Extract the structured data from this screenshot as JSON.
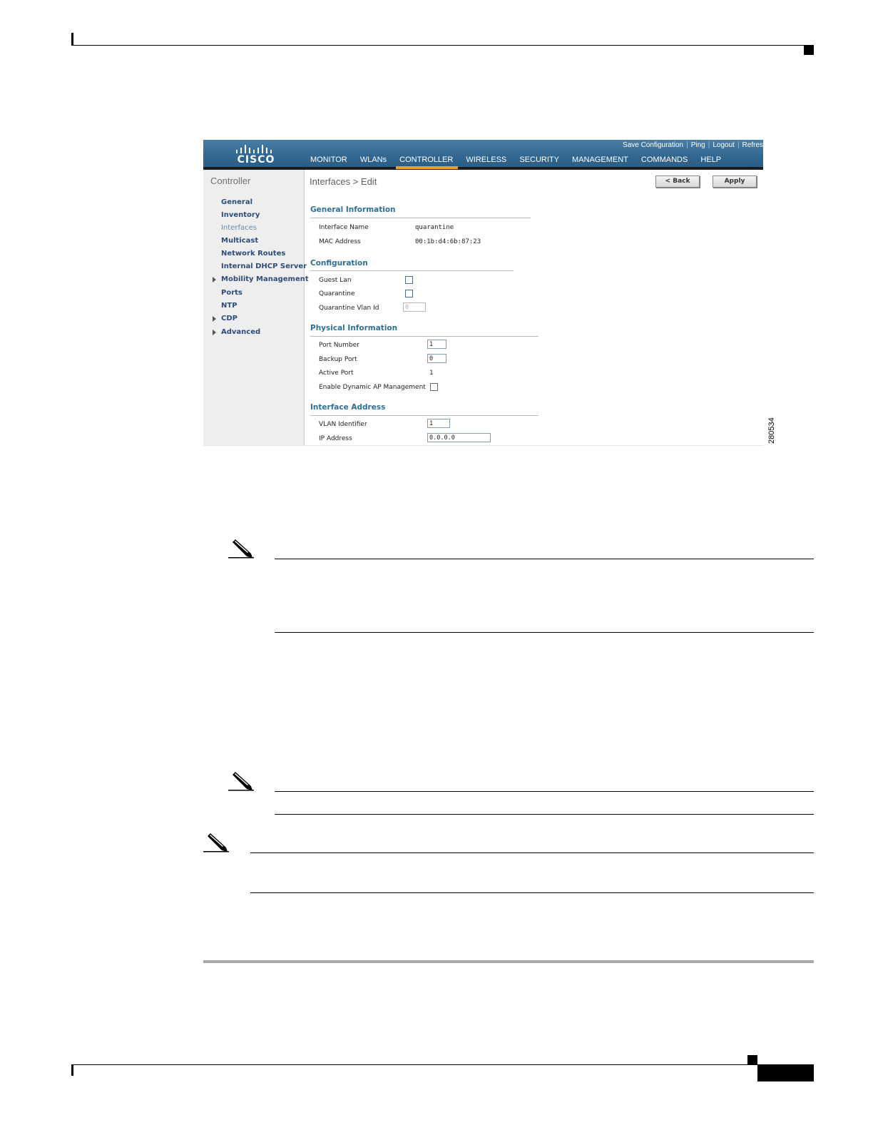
{
  "screenshot": {
    "logo_text": "CISCO",
    "util_links": [
      "Save Configuration",
      "Ping",
      "Logout",
      "Refres"
    ],
    "nav": [
      "MONITOR",
      "WLANs",
      "CONTROLLER",
      "WIRELESS",
      "SECURITY",
      "MANAGEMENT",
      "COMMANDS",
      "HELP"
    ],
    "nav_active": "CONTROLLER",
    "sidebar": {
      "title": "Controller",
      "items": [
        "General",
        "Inventory",
        "Interfaces",
        "Multicast",
        "Network Routes",
        "Internal DHCP Server",
        "Mobility Management",
        "Ports",
        "NTP",
        "CDP",
        "Advanced"
      ]
    },
    "page_title": "Interfaces > Edit",
    "buttons": {
      "back": "< Back",
      "apply": "Apply"
    },
    "general": {
      "title": "General Information",
      "interface_name_label": "Interface Name",
      "interface_name": "quarantine",
      "mac_label": "MAC Address",
      "mac": "00:1b:d4:6b:87:23"
    },
    "configuration": {
      "title": "Configuration",
      "guest_lan_label": "Guest Lan",
      "quarantine_label": "Quarantine",
      "quarantine_vlan_label": "Quarantine Vlan Id",
      "quarantine_vlan_value": "0"
    },
    "physical": {
      "title": "Physical Information",
      "port_number_label": "Port Number",
      "port_number": "1",
      "backup_port_label": "Backup Port",
      "backup_port": "0",
      "active_port_label": "Active Port",
      "active_port": "1",
      "dynamic_ap_label": "Enable Dynamic AP Management"
    },
    "address": {
      "title": "Interface Address",
      "vlan_label": "VLAN Identifier",
      "vlan": "1",
      "ip_label": "IP Address",
      "ip": "0.0.0.0"
    },
    "figure_id": "280534"
  }
}
